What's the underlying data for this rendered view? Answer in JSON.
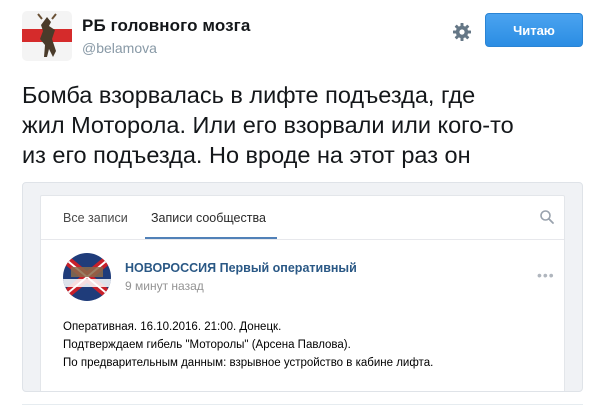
{
  "tweet": {
    "author_name": "РБ головного мозга",
    "author_handle": "@belamova",
    "follow_label": "Читаю",
    "text_lines": [
      "Бомба взорвалась в лифте подъезда, где",
      "жил Моторола. Или его взорвали или кого-то",
      "из его подъезда. Но вроде на этот раз он"
    ]
  },
  "embed": {
    "tabs": [
      "Все записи",
      "Записи сообщества"
    ],
    "active_tab": "Записи сообщества",
    "post": {
      "author": "НОВОРОССИЯ Первый оперативный",
      "avatar_text": "НОВОРОССИЯ",
      "time": "9 минут назад",
      "more": "•••",
      "lines": [
        "Оперативная. 16.10.2016. 21:00. Донецк.",
        "Подтверждаем гибель \"Моторолы\" (Арсена Павлова).",
        "По предварительным данным: взрывное устройство в кабине лифта."
      ]
    }
  },
  "colors": {
    "follow_button": "#2b8de3",
    "vk_link": "#2a5885",
    "vk_tab_underline": "#5181b8"
  },
  "icons": [
    "gear-icon",
    "search-icon",
    "more-icon"
  ]
}
